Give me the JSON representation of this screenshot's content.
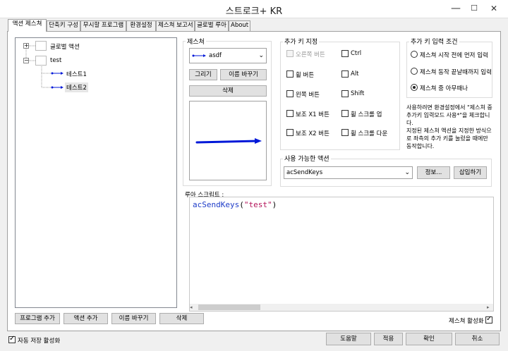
{
  "window": {
    "title": "스트로크+ KR",
    "minimize": "—",
    "maximize": "☐",
    "close": "✕"
  },
  "tabs": [
    "액션 제스쳐",
    "단축키 구성",
    "무시할 프로그램",
    "환경설정",
    "제스쳐 보고서",
    "글로벌 루아",
    "About"
  ],
  "tree": {
    "global": "글로벌 액션",
    "app": "test",
    "children": [
      "테스트1",
      "테스트2"
    ]
  },
  "tree_buttons": [
    "프로그램 추가",
    "액션 추가",
    "이름 바꾸기",
    "삭제"
  ],
  "gesture": {
    "label": "제스쳐",
    "selected": "asdf",
    "draw": "그리기",
    "rename": "이름 바꾸기",
    "delete": "삭제",
    "preview_color": "#0018d8"
  },
  "extra_keys": {
    "label": "추가 키 지정",
    "items": [
      {
        "text": "오른쪽 버튼",
        "checked": false,
        "disabled": true
      },
      {
        "text": "Ctrl",
        "checked": false,
        "disabled": false
      },
      {
        "text": "휠 버튼",
        "checked": false,
        "disabled": false
      },
      {
        "text": "Alt",
        "checked": false,
        "disabled": false
      },
      {
        "text": "왼쪽 버튼",
        "checked": false,
        "disabled": false
      },
      {
        "text": "Shift",
        "checked": false,
        "disabled": false
      },
      {
        "text": "보조 X1 버튼",
        "checked": false,
        "disabled": false
      },
      {
        "text": "휠 스크롤 업",
        "checked": false,
        "disabled": false
      },
      {
        "text": "보조 X2 버튼",
        "checked": false,
        "disabled": false
      },
      {
        "text": "휠 스크롤 다운",
        "checked": false,
        "disabled": false
      }
    ]
  },
  "input_condition": {
    "label": "추가 키 입력 조건",
    "options": [
      "제스쳐 시작 전에 먼저 입력",
      "제스쳐 동작 끝날때까지 입력",
      "제스쳐 중 아무때나"
    ],
    "selected_index": 2,
    "help": [
      "사용하려면 환경설정에서 \"제스쳐 중",
      "추가키 입력모드 사용*\"을 체크합니",
      "다.",
      "지정된 제스쳐 액션을 지정한 방식으",
      "로 좌측의 추가 키를 눌렀을 때에만",
      "동작합니다."
    ]
  },
  "actions": {
    "label": "사용 가능한 액션",
    "selected": "acSendKeys",
    "info": "정보...",
    "insert": "삽입하기"
  },
  "script": {
    "label": "루아 스크립트 :",
    "fn": "acSendKeys",
    "open": "(",
    "arg": "\"test\"",
    "close": ")",
    "fn_color": "#1e3cc8",
    "arg_color": "#b4145a"
  },
  "gesture_enabled": {
    "text": "제스쳐 활성화",
    "checked": true
  },
  "autosave": {
    "text": "자동 저장 활성화",
    "checked": true
  },
  "footer_buttons": [
    "도움말",
    "적용",
    "확인",
    "취소"
  ]
}
